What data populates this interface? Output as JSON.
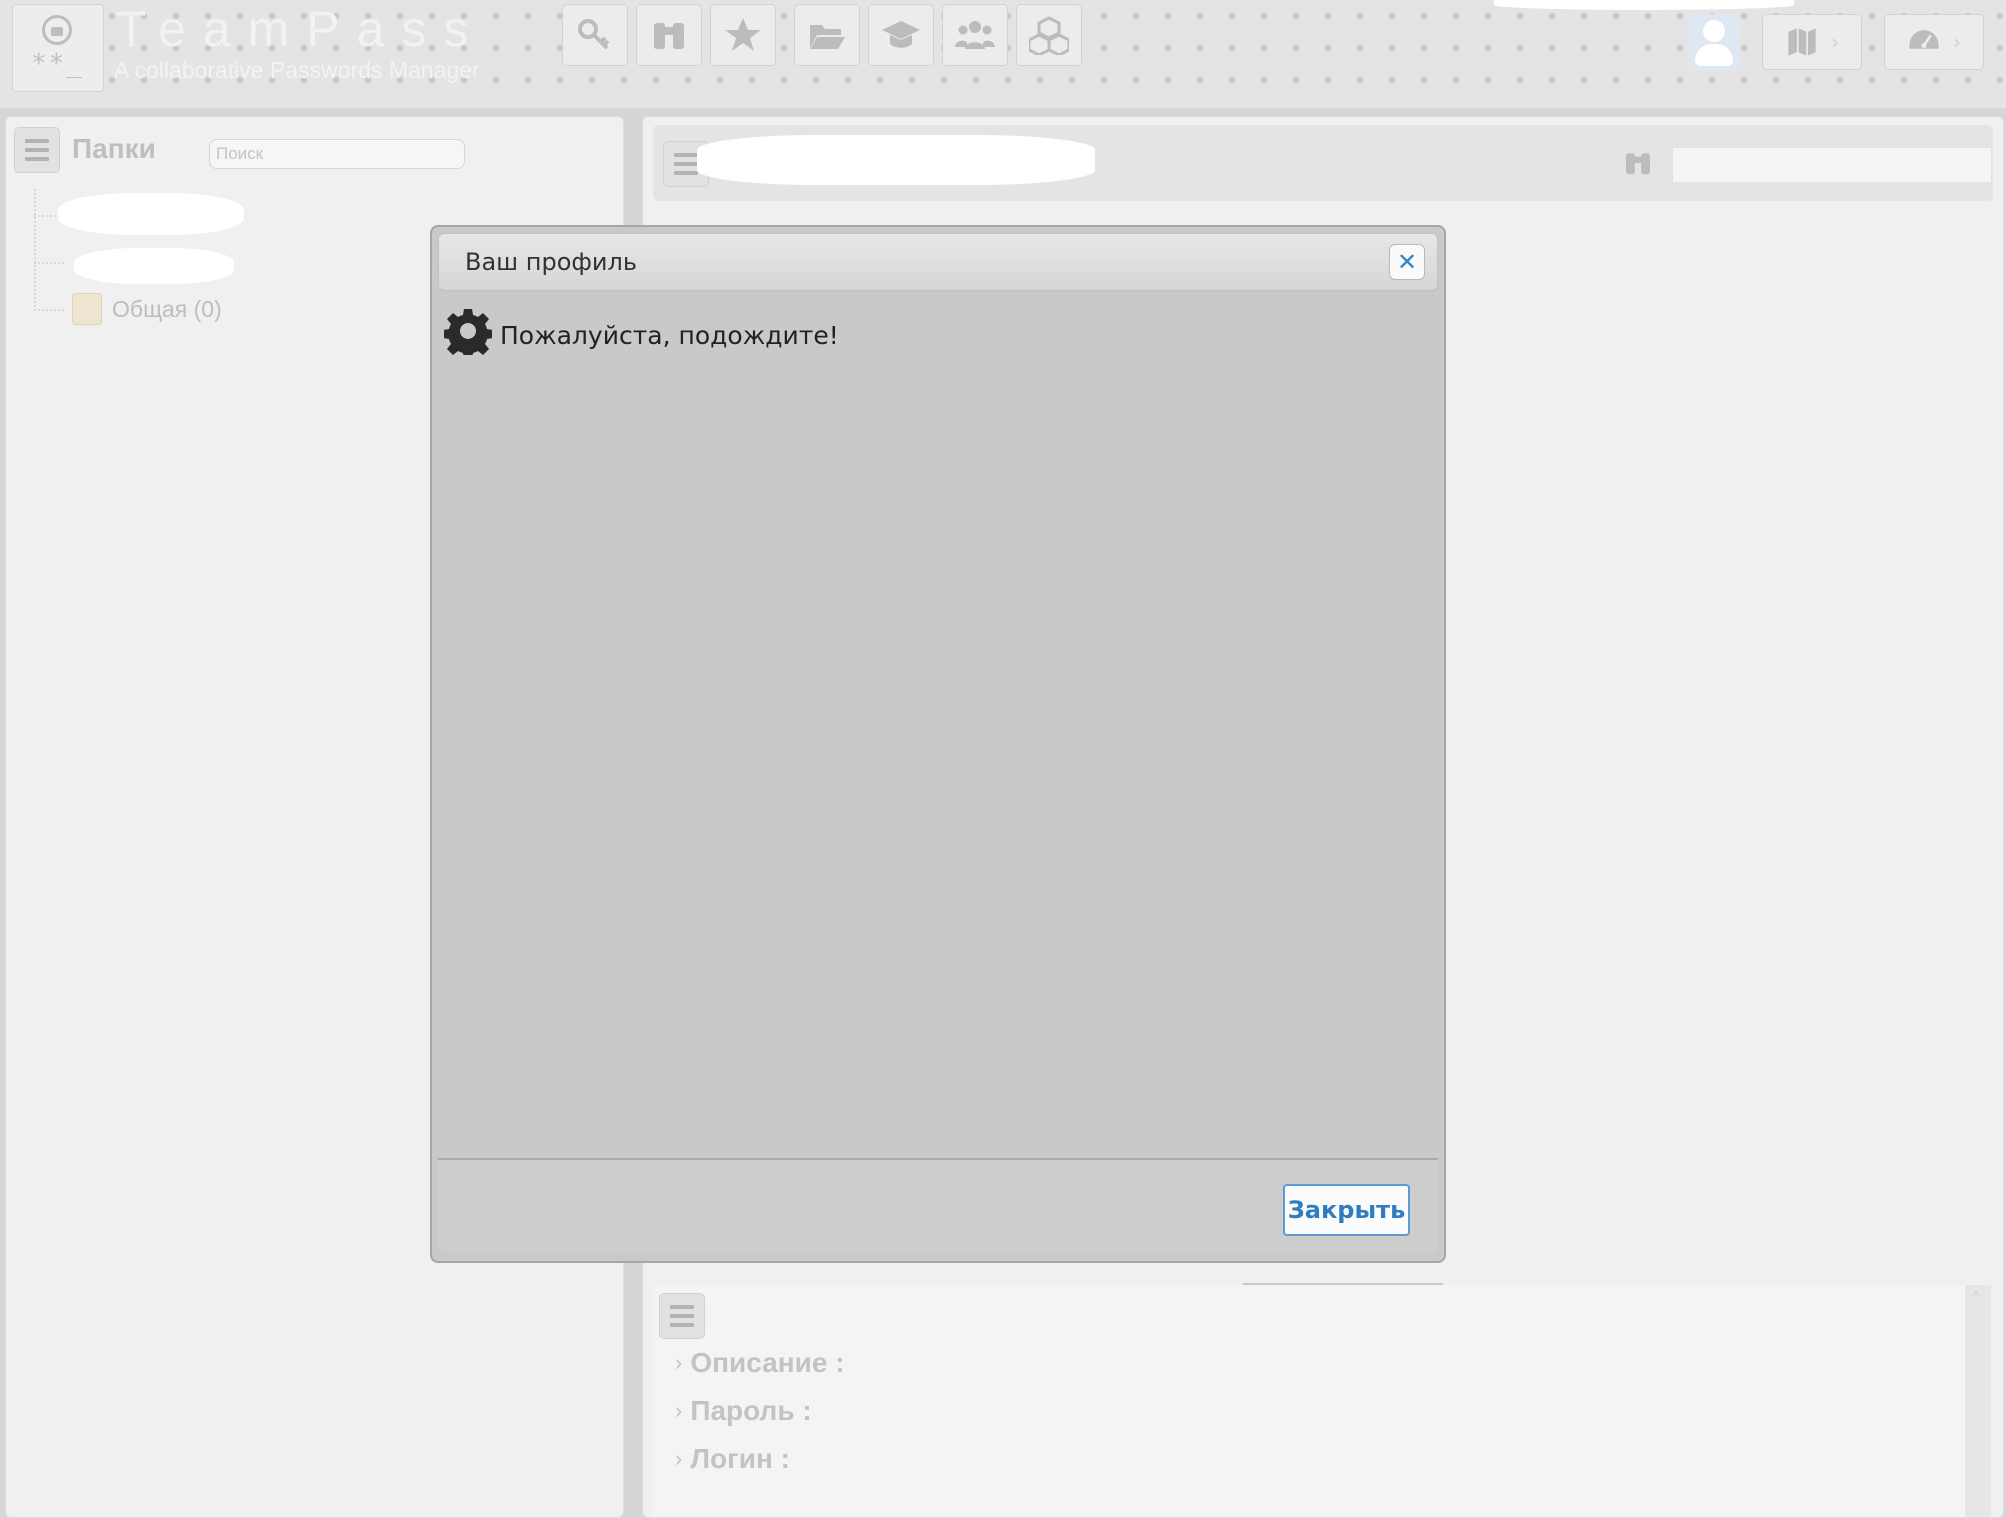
{
  "header": {
    "app_title": "TeamPass",
    "app_subtitle": "A collaborative Passwords Manager",
    "toolbar_icons": [
      "key-icon",
      "binoculars-icon",
      "star-icon",
      "folder-open-icon",
      "graduation-cap-icon",
      "users-icon",
      "cubes-icon"
    ],
    "right_icons": [
      "user-avatar",
      "map-icon",
      "dashboard-icon"
    ]
  },
  "folders_panel": {
    "title": "Папки",
    "search_placeholder": "Поиск",
    "folders": [
      {
        "label": "Общая (0)"
      }
    ]
  },
  "items_panel": {
    "details": {
      "description_label": "Описание :",
      "password_label": "Пароль :",
      "login_label": "Логин :"
    }
  },
  "dialog": {
    "title": "Ваш профиль",
    "message": "Пожалуйста, подождите!",
    "close_button": "Закрыть",
    "close_icon": "close-icon",
    "loading_icon": "gear-icon"
  },
  "colors": {
    "dialog_background": "#c9c9c9",
    "close_button_text": "#2f7dc0",
    "close_button_border": "#5b9bd5"
  }
}
